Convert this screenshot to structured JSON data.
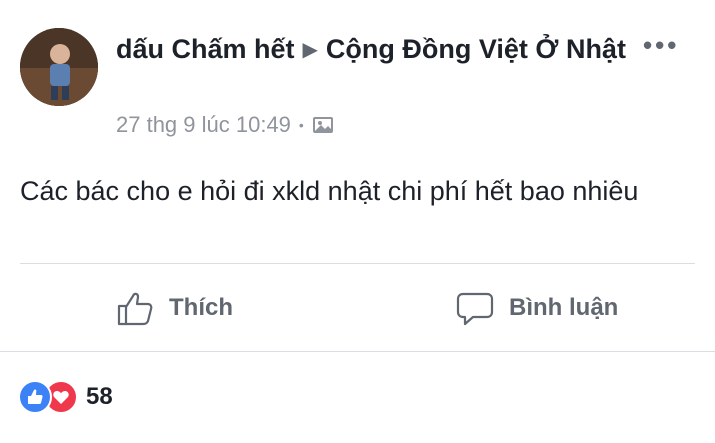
{
  "post": {
    "author": "dấu Chấm hết",
    "group": "Cộng Đồng Việt Ở Nhật",
    "timestamp": "27 thg 9 lúc 10:49",
    "audience_icon": "photo-icon",
    "more_label": "•••",
    "text": "Các bác cho e hỏi đi xkld nhật chi phí hết bao nhiêu"
  },
  "actions": {
    "like_label": "Thích",
    "comment_label": "Bình luận"
  },
  "reactions": {
    "types": [
      "like",
      "love"
    ],
    "count": "58"
  },
  "colors": {
    "like_blue": "#3b82f6",
    "love_red": "#f0384c",
    "secondary_text": "#606770",
    "meta_text": "#90949c"
  }
}
